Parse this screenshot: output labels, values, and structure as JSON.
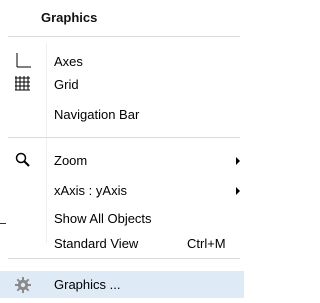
{
  "menu": {
    "title": "Graphics",
    "items": [
      {
        "label": "Axes",
        "icon": "axes-icon"
      },
      {
        "label": "Grid",
        "icon": "grid-icon"
      },
      {
        "label": "Navigation Bar"
      },
      {
        "label": "Zoom",
        "icon": "zoom-icon",
        "submenu": true
      },
      {
        "label": "xAxis : yAxis",
        "submenu": true
      },
      {
        "label": "Show All Objects"
      },
      {
        "label": "Standard View",
        "shortcut": "Ctrl+M"
      },
      {
        "label": "Graphics ...",
        "icon": "gear-icon",
        "highlighted": true
      }
    ]
  },
  "colors": {
    "highlight": "#dfeaf7",
    "separator": "#d9d9d9"
  }
}
